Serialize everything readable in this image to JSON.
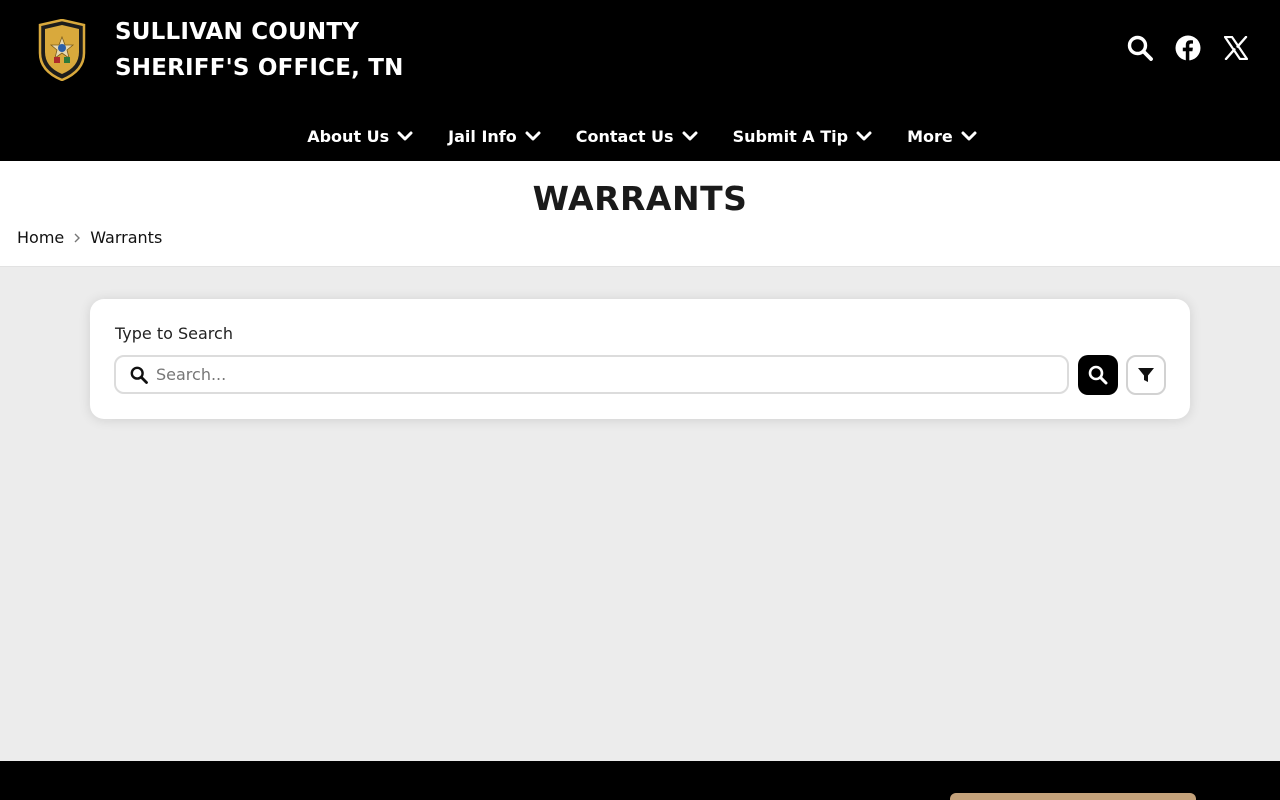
{
  "header": {
    "title_line1": "SULLIVAN COUNTY",
    "title_line2": "SHERIFF'S OFFICE, TN",
    "logo_icon": "sheriff-badge-logo",
    "icons": [
      "search-icon",
      "facebook-icon",
      "x-twitter-icon"
    ]
  },
  "nav": {
    "items": [
      {
        "label": "About Us"
      },
      {
        "label": "Jail Info"
      },
      {
        "label": "Contact Us"
      },
      {
        "label": "Submit A Tip"
      },
      {
        "label": "More"
      }
    ]
  },
  "page": {
    "title": "WARRANTS",
    "breadcrumb": [
      "Home",
      "Warrants"
    ]
  },
  "search": {
    "label": "Type to Search",
    "placeholder": "Search...",
    "value": ""
  },
  "colors": {
    "header_bg": "#000000",
    "page_bg": "#ececec",
    "accent": "#c4a27b"
  }
}
